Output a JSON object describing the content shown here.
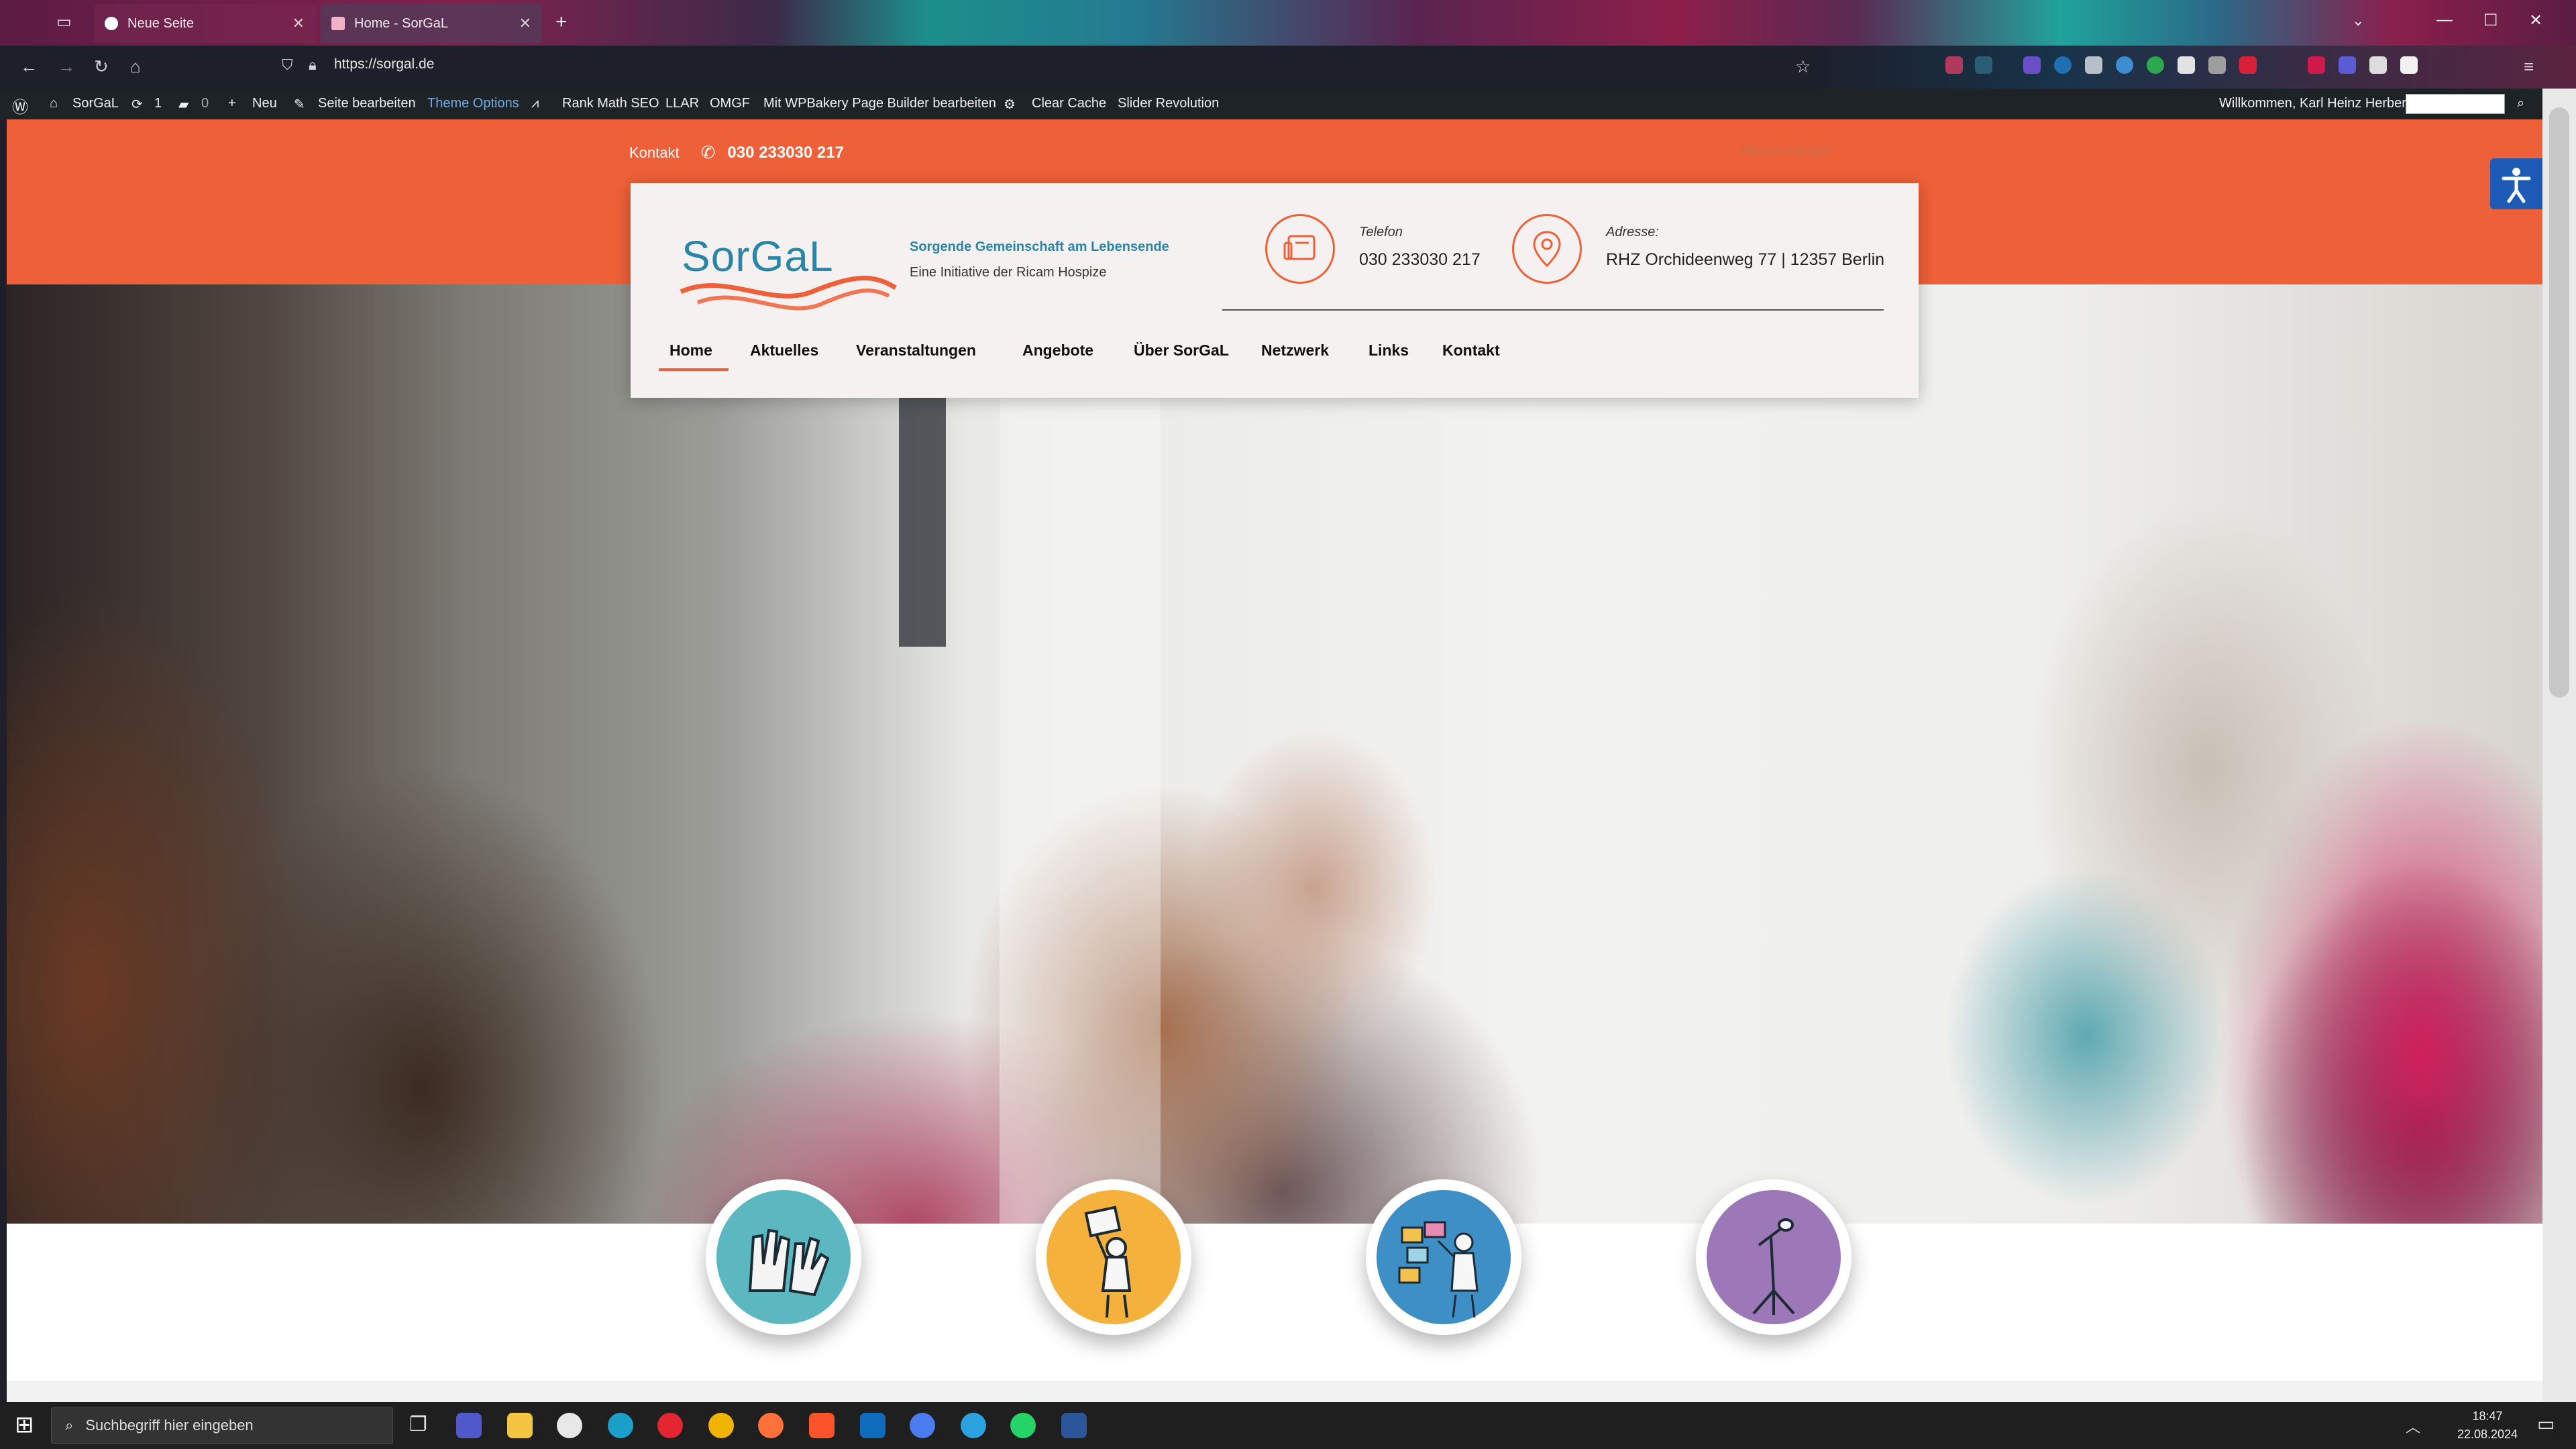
{
  "browser": {
    "tabs": [
      {
        "label": "Neue Seite",
        "active": false
      },
      {
        "label": "Home - SorGaL",
        "active": true
      }
    ],
    "url": "https://sorgal.de",
    "new_tab_glyph": "+"
  },
  "wp_admin_bar": {
    "site_name": "SorGaL",
    "updates_count": "1",
    "comments_count": "0",
    "new_label": "Neu",
    "edit_page": "Seite bearbeiten",
    "theme_options": "Theme Options",
    "rank_math": "Rank Math SEO",
    "llar": "LLAR",
    "omgf": "OMGF",
    "wpbakery": "Mit WPBakery Page Builder bearbeiten",
    "clear_cache": "Clear Cache",
    "slider_revolution": "Slider Revolution",
    "greeting": "Willkommen, Karl Heinz Herber"
  },
  "site": {
    "topbar": {
      "contact_label": "Kontakt",
      "phone": "030 233030 217",
      "right_link": "Ricam Hospiz"
    },
    "logo": {
      "text": "SorGaL",
      "tagline_main": "Sorgende Gemeinschaft am Lebensende",
      "tagline_sub": "Eine Initiative der Ricam Hospize"
    },
    "phone_info": {
      "label": "Telefon",
      "value": "030 233030 217"
    },
    "address_info": {
      "label": "Adresse:",
      "value": "RHZ Orchideenweg 77 | 12357 Berlin"
    },
    "menu": [
      {
        "label": "Home",
        "active": true
      },
      {
        "label": "Aktuelles"
      },
      {
        "label": "Veranstaltungen"
      },
      {
        "label": "Angebote"
      },
      {
        "label": "Über SorGaL"
      },
      {
        "label": "Netzwerk"
      },
      {
        "label": "Links"
      },
      {
        "label": "Kontakt"
      }
    ],
    "service_icons": [
      "raised-hands-icon",
      "sign-holder-icon",
      "board-presenter-icon",
      "microphone-icon"
    ],
    "colors": {
      "brand_orange": "#ee6038",
      "brand_teal": "#2a86a8",
      "circle_1": "#5bb8c0",
      "circle_2": "#f4b23c",
      "circle_3": "#3d8fc6",
      "circle_4": "#9d78b8"
    }
  },
  "taskbar": {
    "search_placeholder": "Suchbegriff hier eingeben",
    "time": "18:47",
    "date": "22.08.2024"
  }
}
